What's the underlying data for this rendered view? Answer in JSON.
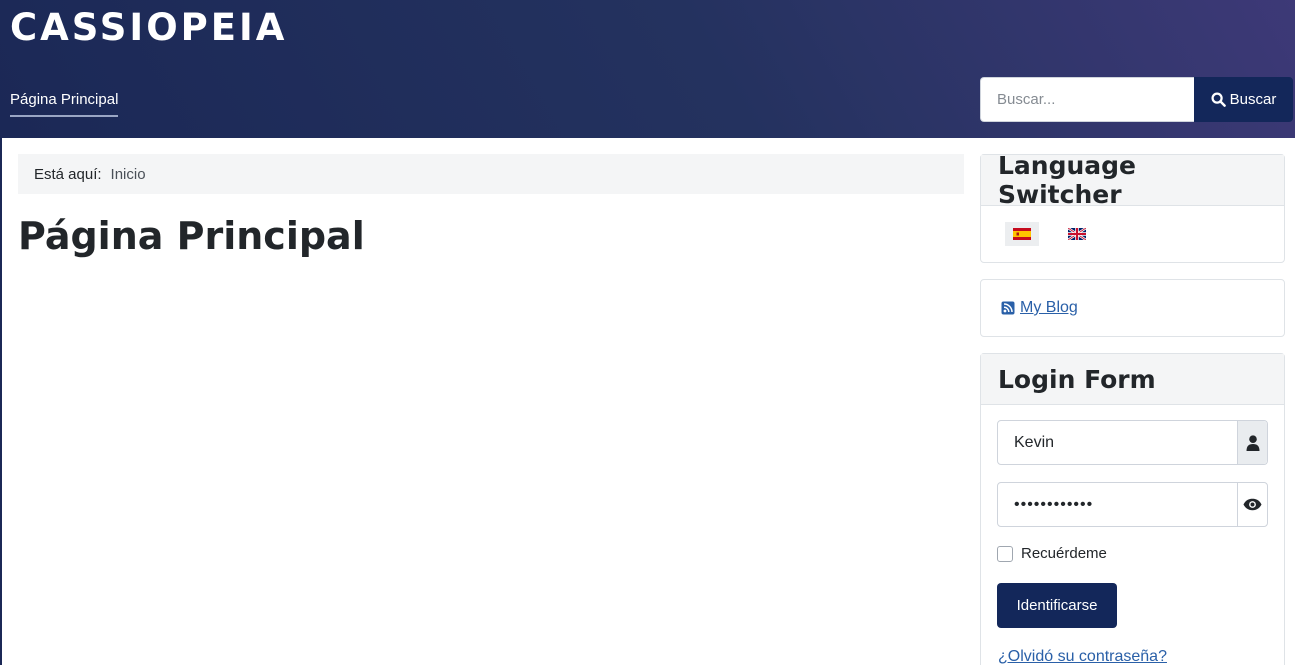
{
  "header": {
    "brand": "CASSIOPEIA",
    "nav_home": "Página Principal",
    "search_placeholder": "Buscar...",
    "search_button": "Buscar",
    "search_icon": "search-icon",
    "gradient_colors": [
      "#1b2856",
      "#3d3977"
    ]
  },
  "breadcrumb": {
    "here_label": "Está aquí:",
    "items": [
      "Inicio"
    ]
  },
  "main": {
    "title": "Página Principal"
  },
  "sidebar": {
    "language_switcher": {
      "title": "Language Switcher",
      "languages": [
        {
          "code": "es",
          "icon": "spain-flag-icon",
          "active": true
        },
        {
          "code": "en",
          "icon": "uk-flag-icon",
          "active": false
        }
      ]
    },
    "blog": {
      "label": "My Blog",
      "icon": "rss-icon"
    },
    "login": {
      "title": "Login Form",
      "username_value": "Kevin",
      "password_value": "••••••••••••",
      "user_icon": "user-icon",
      "show_password_icon": "eye-icon",
      "remember_label": "Recuérdeme",
      "remember_checked": false,
      "submit_label": "Identificarse",
      "forgot_label": "¿Olvidó su contraseña?"
    }
  },
  "colors": {
    "primary_button": "#13275a",
    "link": "#2a60a8"
  }
}
